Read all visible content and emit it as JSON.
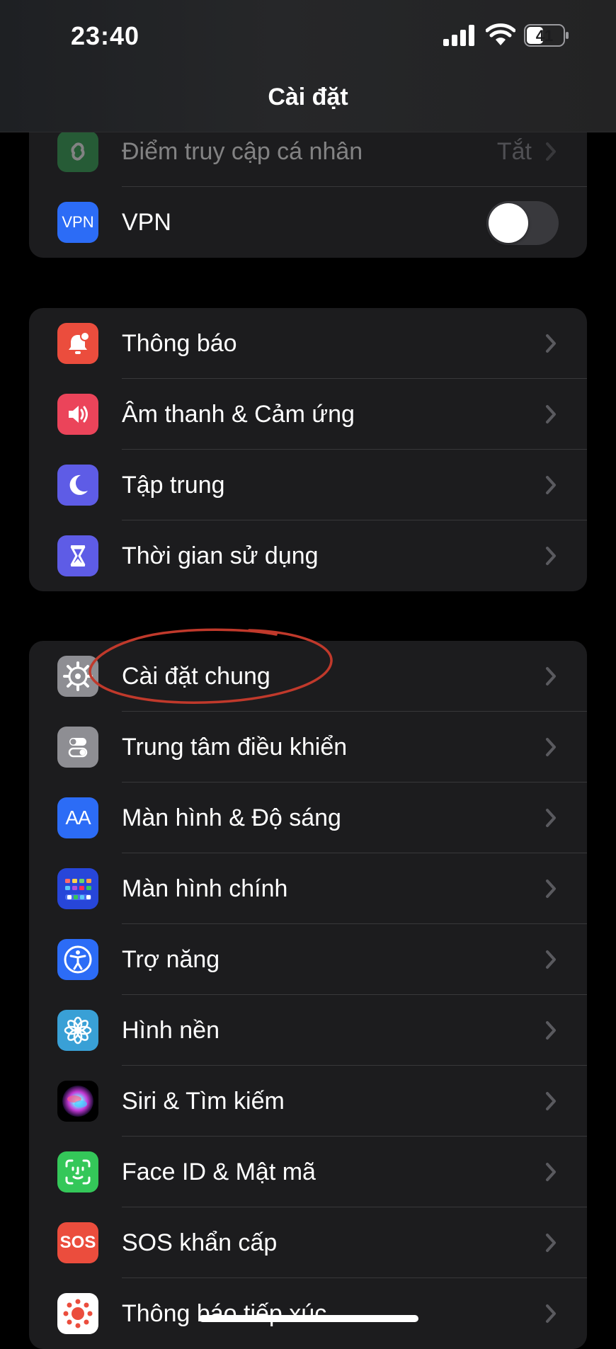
{
  "status_bar": {
    "time": "23:40",
    "battery_level": "41"
  },
  "header": {
    "title": "Cài đặt"
  },
  "groups": [
    {
      "items": [
        {
          "label": "Điểm truy cập cá nhân",
          "value": "Tắt",
          "icon": "personal-hotspot-icon",
          "color": "#34a853"
        },
        {
          "label": "VPN",
          "icon_text": "VPN",
          "icon": "vpn-icon",
          "color": "#2c6cf6",
          "toggle_on": false
        }
      ]
    },
    {
      "items": [
        {
          "label": "Thông báo",
          "icon": "bell-icon",
          "color": "#eb4d3d"
        },
        {
          "label": "Âm thanh & Cảm ứng",
          "icon": "speaker-icon",
          "color": "#eb445a"
        },
        {
          "label": "Tập trung",
          "icon": "moon-icon",
          "color": "#5e5ce6"
        },
        {
          "label": "Thời gian sử dụng",
          "icon": "hourglass-icon",
          "color": "#5e5ce6"
        }
      ]
    },
    {
      "items": [
        {
          "label": "Cài đặt chung",
          "icon": "gear-icon",
          "color": "#8e8e93"
        },
        {
          "label": "Trung tâm điều khiển",
          "icon": "switches-icon",
          "color": "#8e8e93"
        },
        {
          "label": "Màn hình & Độ sáng",
          "icon_text": "AA",
          "icon": "text-size-icon",
          "color": "#2c6cf6"
        },
        {
          "label": "Màn hình chính",
          "icon": "home-screen-grid-icon",
          "color": "#2746d9"
        },
        {
          "label": "Trợ năng",
          "icon": "accessibility-icon",
          "color": "#2c6cf6"
        },
        {
          "label": "Hình nền",
          "icon": "flower-icon",
          "color": "#39a0d6"
        },
        {
          "label": "Siri & Tìm kiếm",
          "icon": "siri-icon",
          "color": "#000000"
        },
        {
          "label": "Face ID & Mật mã",
          "icon": "face-id-icon",
          "color": "#34c759"
        },
        {
          "label": "SOS khẩn cấp",
          "icon_text": "SOS",
          "icon": "sos-icon",
          "color": "#eb4d3d"
        },
        {
          "label": "Thông báo tiếp xúc",
          "icon": "exposure-notification-icon",
          "color": "#ffffff"
        }
      ]
    }
  ],
  "annotation_color": "#c0392b"
}
